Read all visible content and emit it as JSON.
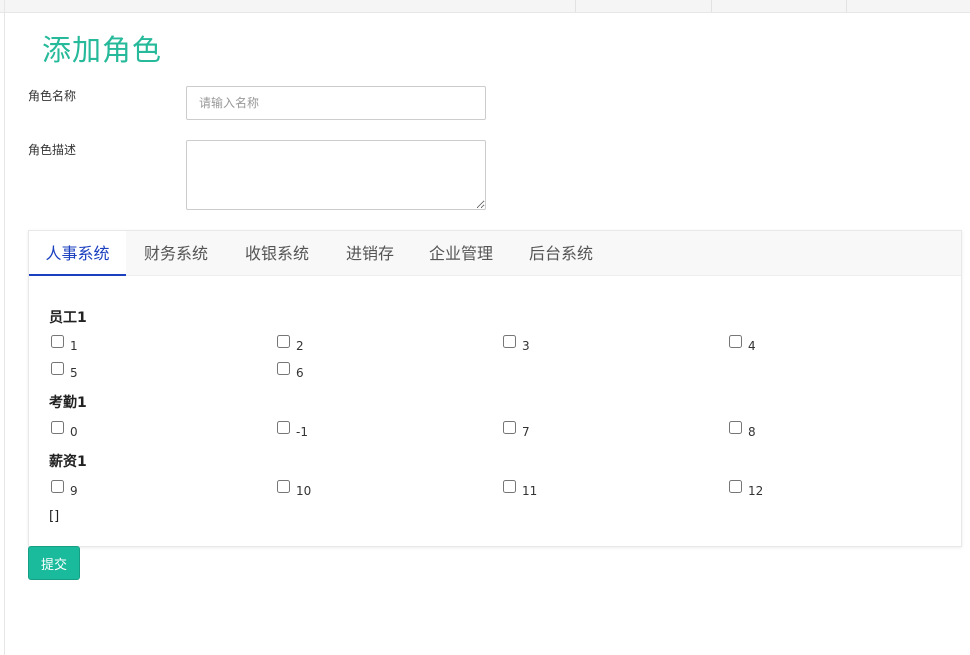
{
  "page": {
    "title": "添加角色"
  },
  "form": {
    "name_label": "角色名称",
    "name_placeholder": "请输入名称",
    "name_value": "",
    "desc_label": "角色描述",
    "desc_value": ""
  },
  "tabs": [
    {
      "label": "人事系统",
      "active": true
    },
    {
      "label": "财务系统",
      "active": false
    },
    {
      "label": "收银系统",
      "active": false
    },
    {
      "label": "进销存",
      "active": false
    },
    {
      "label": "企业管理",
      "active": false
    },
    {
      "label": "后台系统",
      "active": false
    }
  ],
  "groups": [
    {
      "title": "员工1",
      "items": [
        "1",
        "2",
        "3",
        "4",
        "5",
        "6"
      ]
    },
    {
      "title": "考勤1",
      "items": [
        "0",
        "-1",
        "7",
        "8"
      ]
    },
    {
      "title": "薪资1",
      "items": [
        "9",
        "10",
        "11",
        "12"
      ]
    }
  ],
  "selection_output": "[]",
  "submit_label": "提交",
  "colors": {
    "title": "#26b99a",
    "active_tab": "#1a3fbf",
    "submit_bg": "#1abb9c"
  }
}
